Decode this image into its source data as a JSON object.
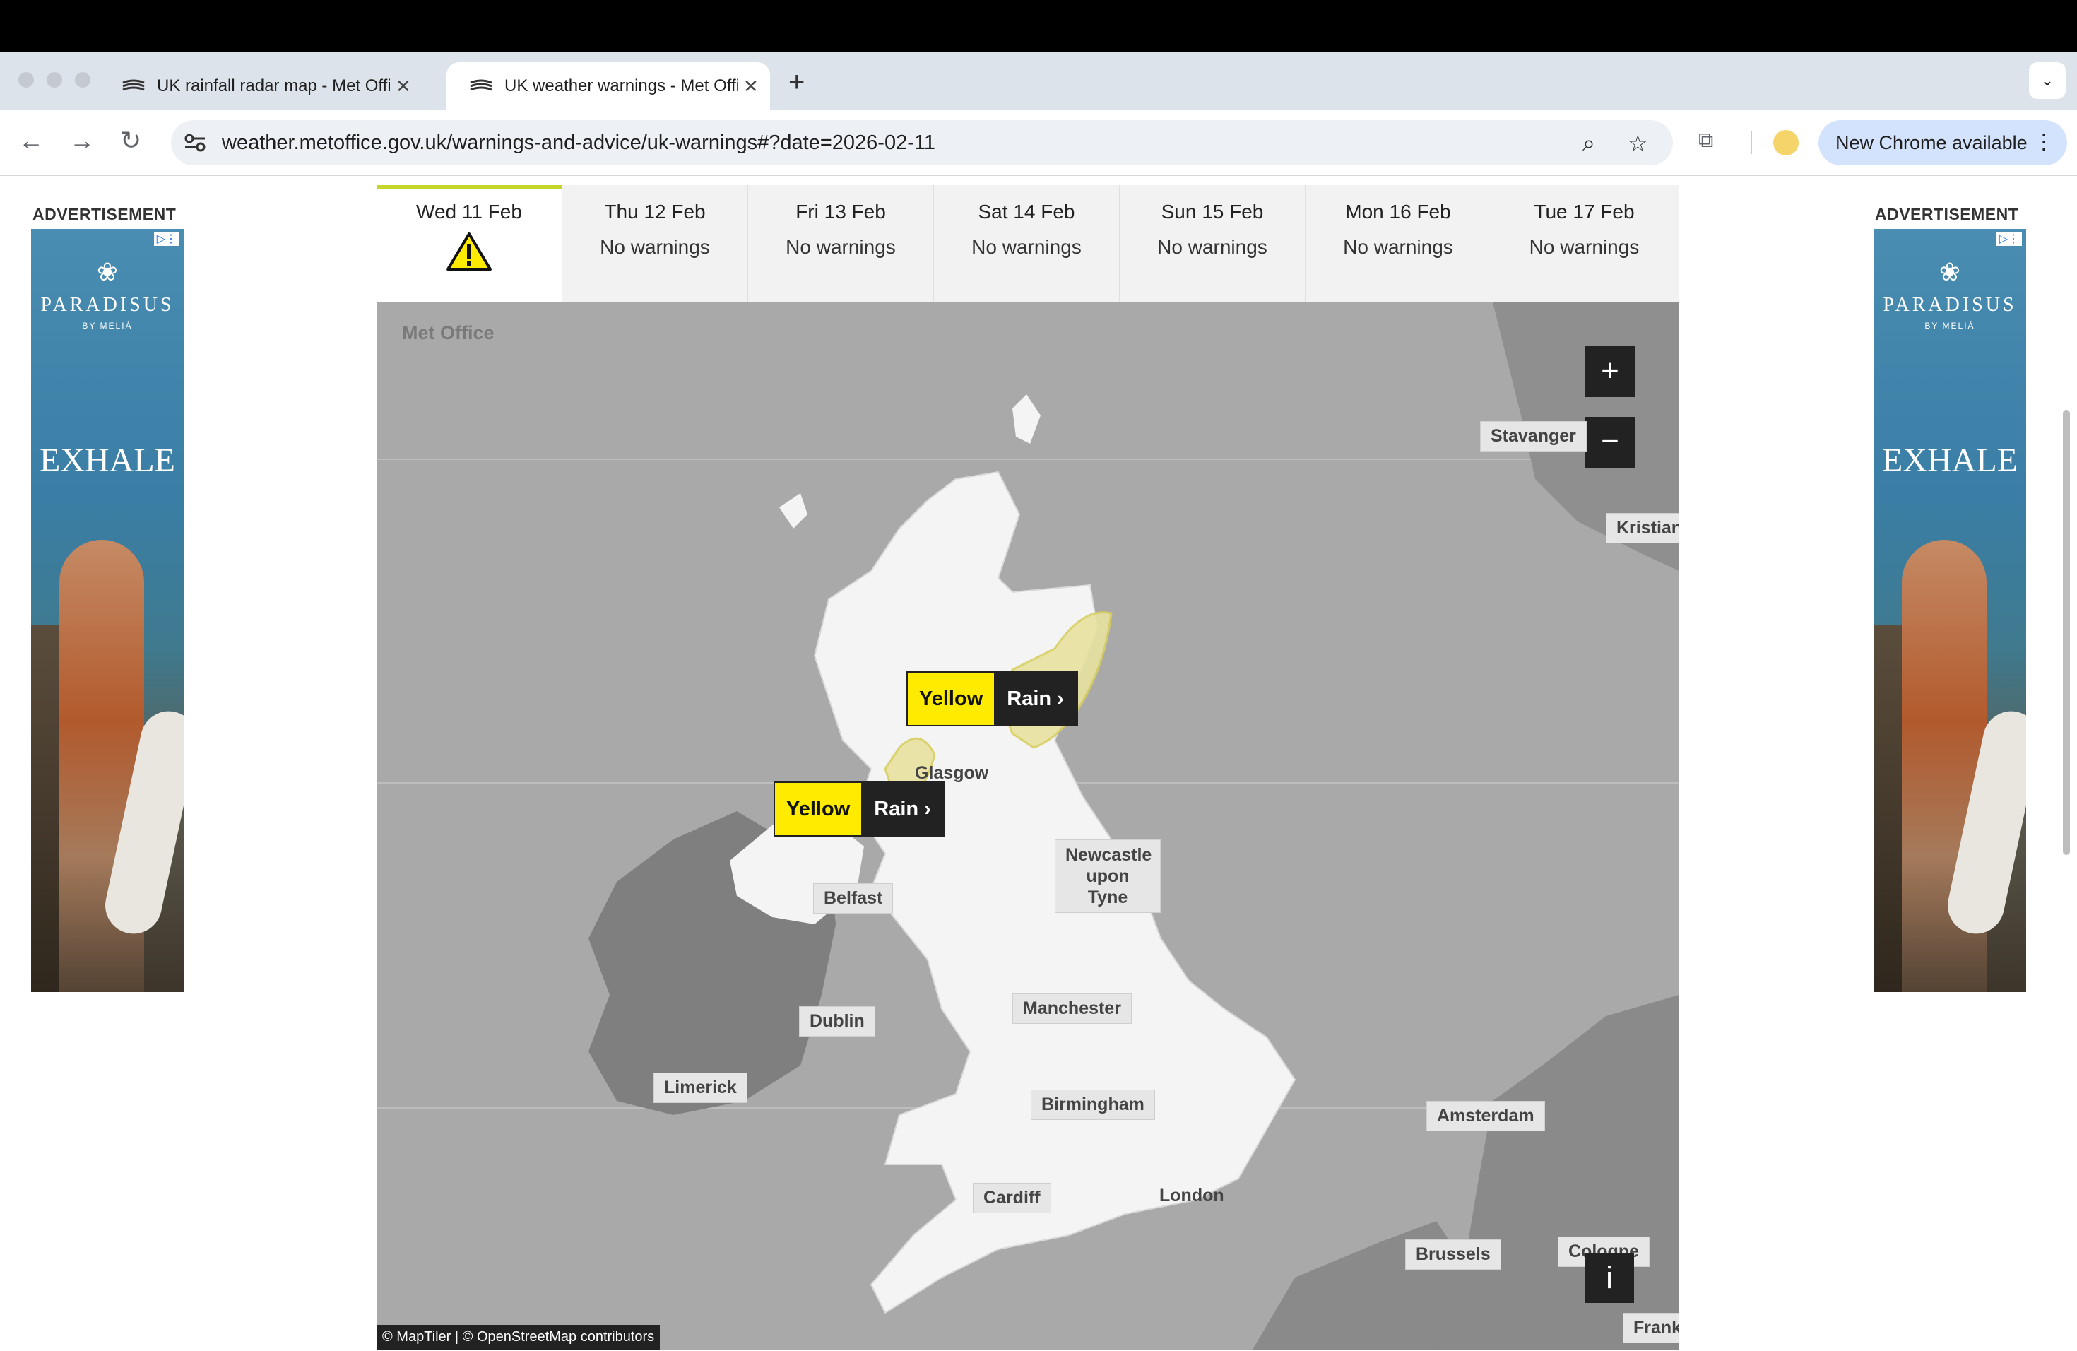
{
  "browser": {
    "tabs": [
      {
        "title": "UK rainfall radar map - Met Office",
        "close": "✕"
      },
      {
        "title": "UK weather warnings - Met Office",
        "close": "✕"
      }
    ],
    "new_tab_symbol": "+",
    "tab_list_symbol": "⌄",
    "url": "weather.metoffice.gov.uk/warnings-and-advice/uk-warnings#?date=2026-02-11",
    "update_button": "New Chrome available"
  },
  "ads": {
    "label": "ADVERTISEMENT",
    "brand": "PARADISUS",
    "brand_sub": "BY MELIÁ",
    "headline": "EXHALE"
  },
  "days": [
    {
      "name": "Wed 11 Feb",
      "status": "",
      "has_warning": true
    },
    {
      "name": "Thu 12 Feb",
      "status": "No warnings"
    },
    {
      "name": "Fri 13 Feb",
      "status": "No warnings"
    },
    {
      "name": "Sat 14 Feb",
      "status": "No warnings"
    },
    {
      "name": "Sun 15 Feb",
      "status": "No warnings"
    },
    {
      "name": "Mon 16 Feb",
      "status": "No warnings"
    },
    {
      "name": "Tue 17 Feb",
      "status": "No warnings"
    }
  ],
  "map": {
    "logo": "Met Office",
    "zoom_in": "+",
    "zoom_out": "−",
    "info": "i",
    "attribution": "© MapTiler | © OpenStreetMap contributors",
    "cities": {
      "stavanger": "Stavanger",
      "kristiansand": "Kristians",
      "glasgow": "Glasgow",
      "newcastle": "Newcastle upon Tyne",
      "belfast": "Belfast",
      "dublin": "Dublin",
      "manchester": "Manchester",
      "limerick": "Limerick",
      "birmingham": "Birmingham",
      "amsterdam": "Amsterdam",
      "cardiff": "Cardiff",
      "london": "London",
      "brussels": "Brussels",
      "cologne": "Cologne",
      "frankfurt": "Frankf"
    },
    "warnings": [
      {
        "level": "Yellow",
        "type": "Rain ›"
      },
      {
        "level": "Yellow",
        "type": "Rain ›"
      }
    ],
    "colors": {
      "yellow": "#ffeb00",
      "land": "#f4f4f4",
      "sea": "#a9a9a9"
    }
  }
}
